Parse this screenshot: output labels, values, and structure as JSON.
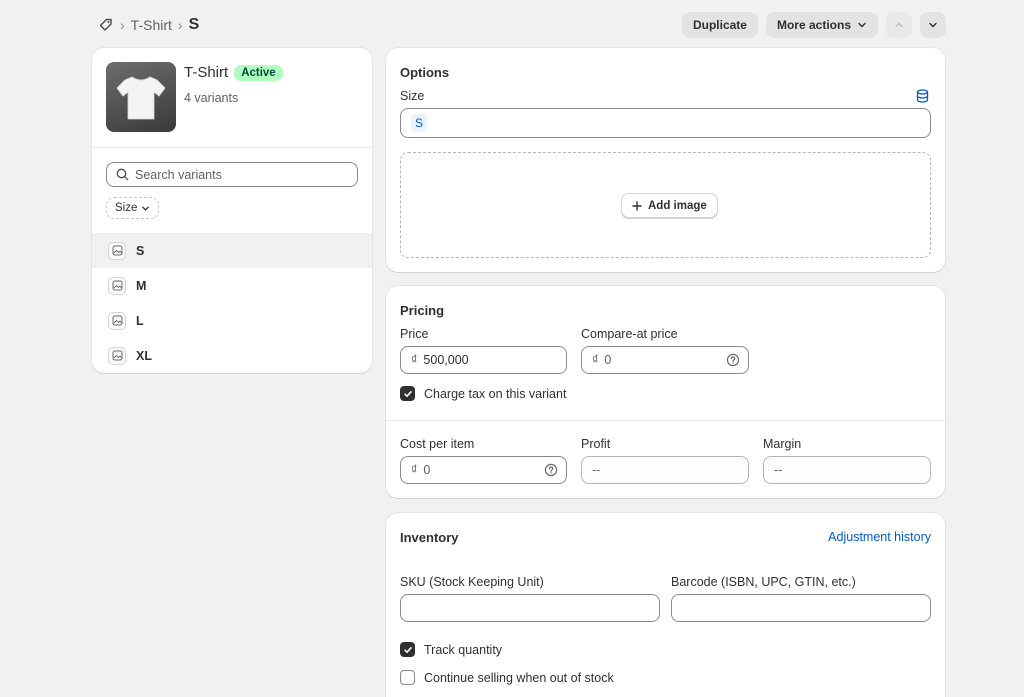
{
  "breadcrumb": {
    "parent": "T-Shirt",
    "current": "S"
  },
  "header_actions": {
    "duplicate_label": "Duplicate",
    "more_actions_label": "More actions"
  },
  "product": {
    "title": "T-Shirt",
    "status": "Active",
    "variant_count": "4 variants"
  },
  "variant_list": {
    "search_placeholder": "Search variants",
    "filter_label": "Size",
    "items": [
      {
        "label": "S",
        "selected": true
      },
      {
        "label": "M",
        "selected": false
      },
      {
        "label": "L",
        "selected": false
      },
      {
        "label": "XL",
        "selected": false
      }
    ]
  },
  "options": {
    "title": "Options",
    "size_label": "Size",
    "size_value": "S",
    "add_image_label": "Add image"
  },
  "pricing": {
    "title": "Pricing",
    "price_label": "Price",
    "currency_symbol": "₫",
    "price_value": "500,000",
    "compare_label": "Compare-at price",
    "compare_value": "0",
    "charge_tax_label": "Charge tax on this variant",
    "charge_tax_checked": true,
    "cost_label": "Cost per item",
    "cost_value": "0",
    "profit_label": "Profit",
    "profit_value": "--",
    "margin_label": "Margin",
    "margin_value": "--"
  },
  "inventory": {
    "title": "Inventory",
    "adjustment_link": "Adjustment history",
    "sku_label": "SKU (Stock Keeping Unit)",
    "sku_value": "",
    "barcode_label": "Barcode (ISBN, UPC, GTIN, etc.)",
    "barcode_value": "",
    "track_quantity_label": "Track quantity",
    "track_quantity_checked": true,
    "continue_selling_label": "Continue selling when out of stock",
    "continue_selling_checked": false
  },
  "colors": {
    "accent_link": "#005bd3",
    "badge_bg": "#affebf",
    "badge_text": "#014b40",
    "page_bg": "#f1f1f1"
  }
}
